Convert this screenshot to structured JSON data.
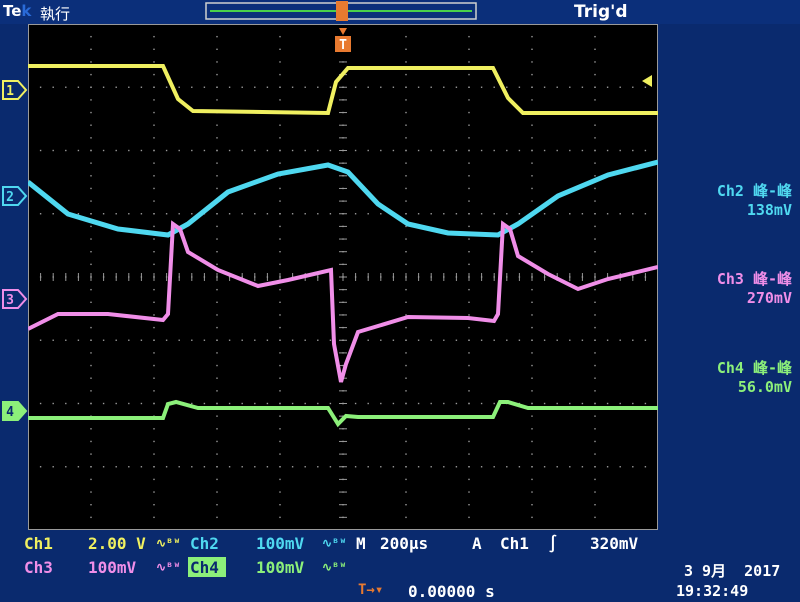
{
  "header": {
    "brand": "Tek",
    "run_state": "執行",
    "trigger_state": "Trig'd"
  },
  "channels": [
    {
      "id": "1",
      "color": "#f0f060"
    },
    {
      "id": "2",
      "color": "#4fd8f0"
    },
    {
      "id": "3",
      "color": "#f08ee8"
    },
    {
      "id": "4",
      "color": "#8cf07a"
    }
  ],
  "trigger_marker": "T",
  "measurements": [
    {
      "label": "Ch2 峰-峰",
      "value": "138mV",
      "color": "#4fd8f0"
    },
    {
      "label": "Ch3 峰-峰",
      "value": "270mV",
      "color": "#f08ee8"
    },
    {
      "label": "Ch4 峰-峰",
      "value": "56.0mV",
      "color": "#8cf07a"
    }
  ],
  "readouts": {
    "ch1_name": "Ch1",
    "ch1_scale": "2.00 V",
    "ch2_name": "Ch2",
    "ch2_scale": "100mV",
    "ch3_name": "Ch3",
    "ch3_scale": "100mV",
    "ch4_name": "Ch4",
    "ch4_scale": "100mV",
    "coupling_glyph": "∿ᴮᵂ",
    "timebase_prefix": "M",
    "timebase": "200µs",
    "trigger_prefix": "A",
    "trigger_source": "Ch1",
    "trigger_slope": "∫",
    "trigger_level": "320mV",
    "position_marker": "T→▾",
    "position": "0.00000 s"
  },
  "datetime": {
    "date": "3 9月  2017",
    "time": "19:32:49"
  }
}
